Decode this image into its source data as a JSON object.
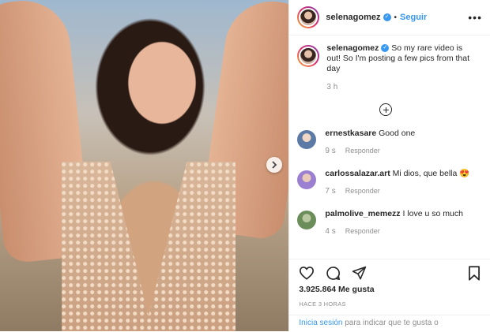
{
  "post": {
    "username": "selenagomez",
    "follow_label": "Seguir",
    "separator": "•",
    "more_label": "•••"
  },
  "caption": {
    "username": "selenagomez",
    "text": " So my rare video is out! So I'm posting a few pics from that day",
    "time": "3 h"
  },
  "comments": [
    {
      "username": "ernestkasare",
      "text": " Good one",
      "time": "9 s",
      "reply": "Responder",
      "avatar_color": "#5b7aa6"
    },
    {
      "username": "carlossalazar.art",
      "text": " Mi dios, que bella 😍",
      "time": "7 s",
      "reply": "Responder",
      "avatar_color": "#9b7fd1"
    },
    {
      "username": "palmolive_memezz",
      "text": " I love u so much",
      "time": "4 s",
      "reply": "Responder",
      "avatar_color": "#6a8d5a"
    }
  ],
  "actions": {
    "likes": "3.925.864 Me gusta",
    "posted": "HACE 3 HORAS"
  },
  "login": {
    "link": "Inicia sesión",
    "text": " para indicar que te gusta o"
  },
  "colors": {
    "accent": "#3897f0",
    "muted": "#8e8e8e",
    "border": "#efefef"
  },
  "icons": [
    "chevron-right-icon",
    "verified-icon",
    "more-icon",
    "plus-circle-icon",
    "heart-icon",
    "comment-icon",
    "share-icon",
    "bookmark-icon"
  ]
}
